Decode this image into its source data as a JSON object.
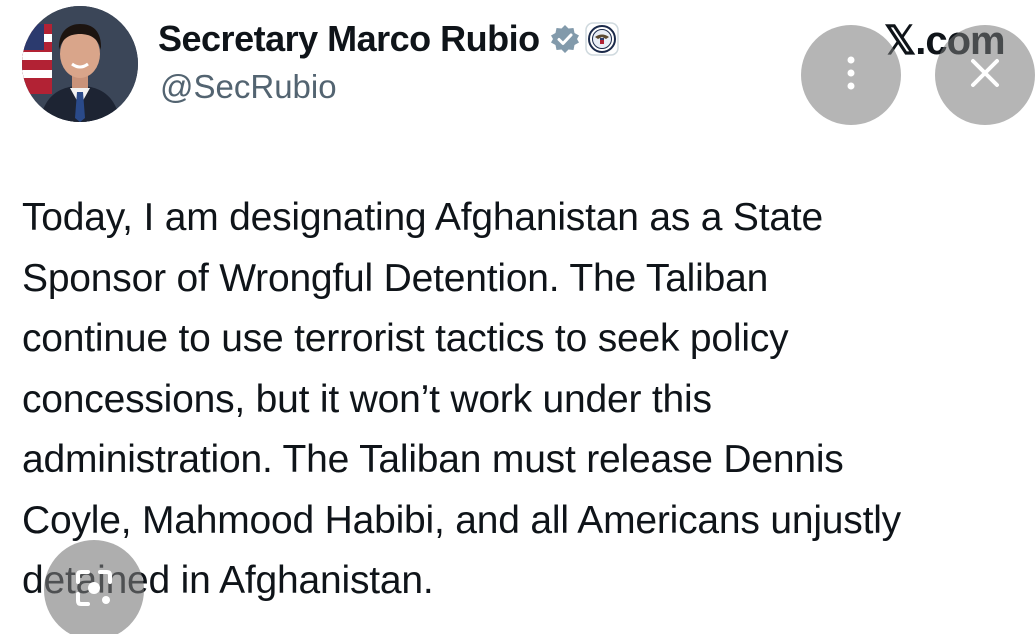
{
  "author": {
    "display_name": "Secretary Marco Rubio",
    "handle": "@SecRubio"
  },
  "site": {
    "label": "𝕏.com"
  },
  "tweet": {
    "text": "Today, I am designating Afghanistan as a State\nSponsor of Wrongful Detention. The Taliban\ncontinue to use terrorist tactics to seek policy\nconcessions, but it won’t work under this\nadministration. The Taliban must release Dennis\nCoyle, Mahmood Habibi, and all Americans unjustly\ndetained in Afghanistan."
  },
  "icons": {
    "verified": "verified-badge-icon",
    "seal": "state-department-seal-icon",
    "more": "more-vertical-icon",
    "close": "close-icon",
    "lens": "lens-search-icon"
  },
  "colors": {
    "text": "#0f1419",
    "muted": "#536471",
    "verified_badge": "#829aab",
    "overlay": "#787878"
  }
}
